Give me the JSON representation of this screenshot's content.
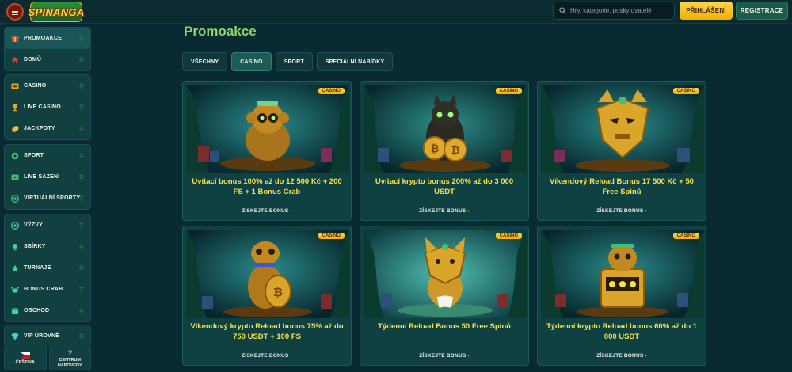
{
  "header": {
    "logo_text": "SPINANGA",
    "search_placeholder": "Hry, kategorie, poskytovatelé",
    "login_label": "PŘIHLÁŠENÍ",
    "register_label": "REGISTRACE"
  },
  "sidebar": {
    "group1": [
      {
        "label": "PROMOAKCE",
        "icon": "gift-icon"
      },
      {
        "label": "DOMŮ",
        "icon": "home-icon"
      }
    ],
    "group2": [
      {
        "label": "CASINO",
        "icon": "slot-icon"
      },
      {
        "label": "LIVE CASINO",
        "icon": "trophy-icon"
      },
      {
        "label": "JACKPOTY",
        "icon": "coins-icon"
      }
    ],
    "group3": [
      {
        "label": "SPORT",
        "icon": "ball-icon"
      },
      {
        "label": "LIVE SÁZENÍ",
        "icon": "live-icon"
      },
      {
        "label": "VIRTUÁLNÍ SPORTY",
        "icon": "virtual-icon"
      }
    ],
    "group4": [
      {
        "label": "VÝZVY",
        "icon": "target-icon"
      },
      {
        "label": "SBÍRKY",
        "icon": "collection-icon"
      },
      {
        "label": "TURNAJE",
        "icon": "tournament-icon"
      },
      {
        "label": "BONUS CRAB",
        "icon": "crab-icon"
      },
      {
        "label": "OBCHOD",
        "icon": "shop-icon"
      }
    ],
    "group5": [
      {
        "label": "VIP ÚROVNĚ",
        "icon": "diamond-icon"
      }
    ],
    "language_label": "ČEŠTINA",
    "help_label_1": "CENTRUM",
    "help_label_2": "NÁPOVĚDY"
  },
  "main": {
    "title": "Promoakce",
    "tabs": [
      "VŠECHNY",
      "CASINO",
      "SPORT",
      "SPECIÁLNÍ NABÍDKY"
    ],
    "active_tab": 1,
    "cards": [
      {
        "badge": "CASINO",
        "title": "Uvítací bonus 100% až do 12 500 Kč + 200 FS + 1 Bonus Crab",
        "link": "ZÍSKEJTE BONUS"
      },
      {
        "badge": "CASINO",
        "title": "Uvítací krypto bonus 200% až do 3 000 USDT",
        "link": "ZÍSKEJTE BONUS"
      },
      {
        "badge": "CASINO",
        "title": "Víkendový Reload Bonus 17 500 Kč + 50 Free Spinů",
        "link": "ZÍSKEJTE BONUS"
      },
      {
        "badge": "CASINO",
        "title": "Víkendový krypto Reload bonus 75% až do 750 USDT + 100 FS",
        "link": "ZÍSKEJTE BONUS"
      },
      {
        "badge": "CASINO",
        "title": "Týdenní Reload Bonus 50 Free Spinů",
        "link": "ZÍSKEJTE BONUS"
      },
      {
        "badge": "CASINO",
        "title": "Týdenní krypto Reload bonus 60% až do 1 000 USDT",
        "link": "ZÍSKEJTE BONUS"
      }
    ]
  },
  "colors": {
    "accent_yellow": "#f4e24d",
    "accent_green": "#8fd66a",
    "button_gold": "#f0b000",
    "background": "#0a2a33"
  }
}
